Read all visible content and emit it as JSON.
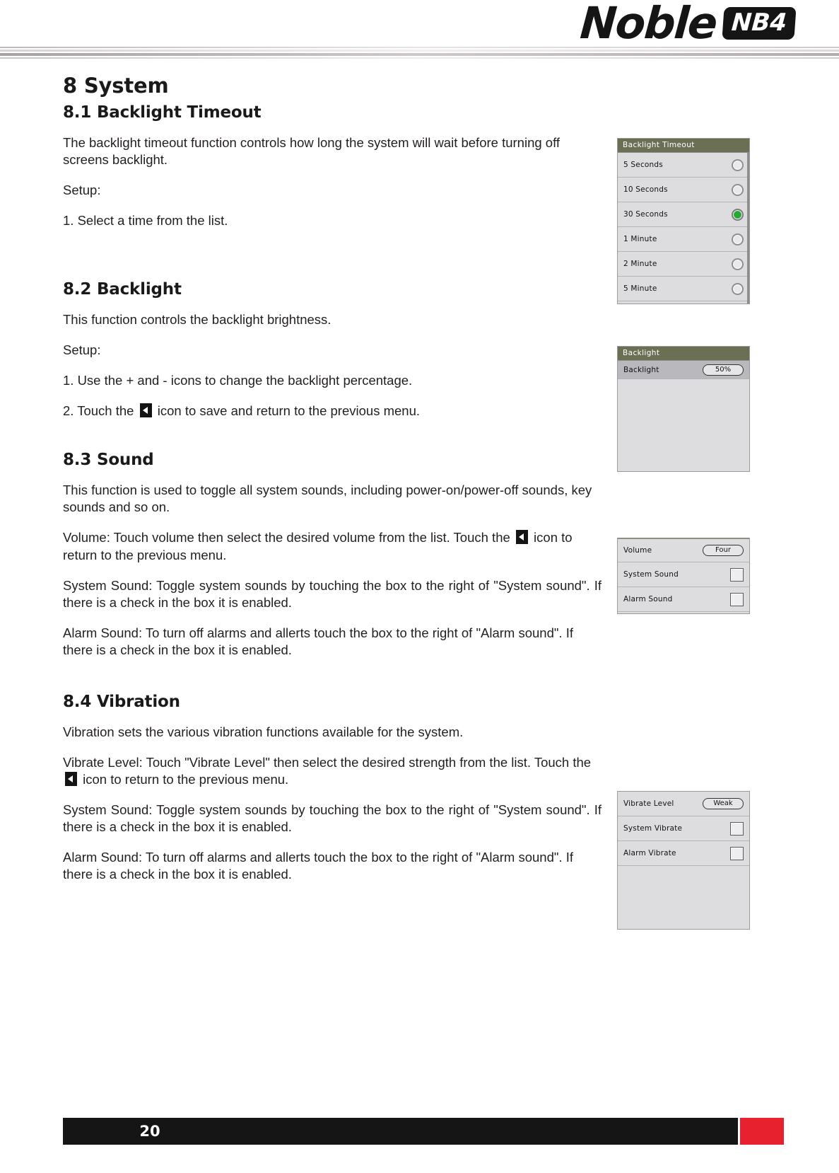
{
  "header": {
    "brand": "Noble",
    "model_badge": "NB4"
  },
  "content": {
    "chapter_title": "8 System",
    "sections": [
      {
        "heading": "8.1 Backlight Timeout",
        "paragraphs": [
          "The backlight timeout function controls how long the system will wait before turning off screens backlight.",
          "Setup:",
          "1. Select a time from the list."
        ]
      },
      {
        "heading": "8.2 Backlight",
        "paragraphs": [
          "This function controls the backlight brightness.",
          "Setup:",
          "1. Use the + and - icons to change the backlight percentage."
        ],
        "step2_pre": "2. Touch the ",
        "step2_post": " icon to save and return to the previous menu."
      },
      {
        "heading": "8.3 Sound",
        "paragraphs": [
          "This function is used to toggle all system sounds, including power-on/power-off sounds, key sounds and so on."
        ],
        "volume_pre": "Volume: Touch volume then select the desired volume from the list. Touch the ",
        "volume_post": " icon to return to the previous menu.",
        "system_sound": "System Sound: Toggle system sounds by touching the box to the right of \"System sound\". If there is a check in the box it is enabled.",
        "alarm_sound": "Alarm Sound: To turn off alarms and allerts touch the box to the right of \"Alarm sound\". If there is a check in the box it is enabled."
      },
      {
        "heading": "8.4 Vibration",
        "paragraphs": [
          "Vibration sets the various vibration functions available for the system."
        ],
        "vibrate_pre": "Vibrate Level: Touch \"Vibrate Level\" then select the desired strength from the list. Touch the ",
        "vibrate_post": " icon to return to the previous menu.",
        "system_sound": "System Sound: Toggle system sounds by touching the box to the right of \"System sound\". If there is a check in the box it is enabled.",
        "alarm_sound": "Alarm Sound: To turn off alarms and allerts touch the box to the right of \"Alarm sound\". If there is a check in the box it is enabled."
      }
    ]
  },
  "panels": {
    "backlight_timeout": {
      "title": "Backlight Timeout",
      "options": [
        {
          "label": "5 Seconds",
          "selected": false
        },
        {
          "label": "10 Seconds",
          "selected": false
        },
        {
          "label": "30 Seconds",
          "selected": true
        },
        {
          "label": "1 Minute",
          "selected": false
        },
        {
          "label": "2 Minute",
          "selected": false
        },
        {
          "label": "5 Minute",
          "selected": false
        }
      ]
    },
    "backlight": {
      "title": "Backlight",
      "row_label": "Backlight",
      "row_value": "50%"
    },
    "sound": {
      "volume_label": "Volume",
      "volume_value": "Four",
      "system_sound_label": "System Sound",
      "alarm_sound_label": "Alarm Sound"
    },
    "vibration": {
      "vibrate_level_label": "Vibrate Level",
      "vibrate_level_value": "Weak",
      "system_vibrate_label": "System Vibrate",
      "alarm_vibrate_label": "Alarm Vibrate"
    }
  },
  "footer": {
    "page_number": "20",
    "accent_color": "#e8212e"
  }
}
